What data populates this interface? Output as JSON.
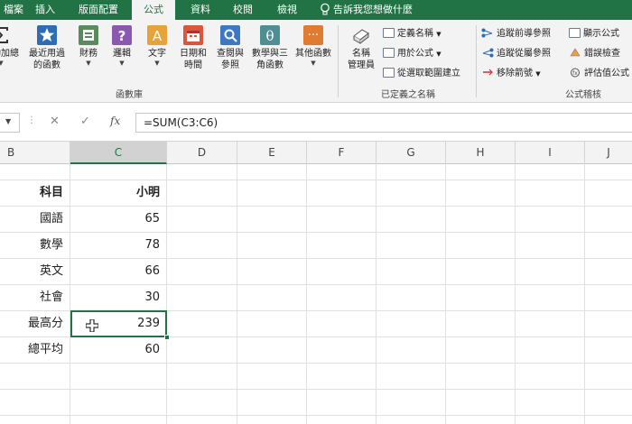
{
  "ribbon_tabs": [
    {
      "label": "檔案"
    },
    {
      "label": "插入"
    },
    {
      "label": "版面配置"
    },
    {
      "label": "公式",
      "active": true
    },
    {
      "label": "資料"
    },
    {
      "label": "校閱"
    },
    {
      "label": "檢視"
    }
  ],
  "tell_me": "告訴我您想做什麼",
  "function_library": {
    "group_label": "函數庫",
    "buttons": [
      {
        "label_1": "自動加總",
        "icon": "autosum-icon"
      },
      {
        "label_1": "最近用過",
        "label_2": "的函數",
        "icon": "recent-star-icon"
      },
      {
        "label_1": "財務",
        "icon": "financial-book-icon"
      },
      {
        "label_1": "邏輯",
        "icon": "logical-question-icon"
      },
      {
        "label_1": "文字",
        "icon": "text-a-icon"
      },
      {
        "label_1": "日期和",
        "label_2": "時間",
        "icon": "calendar-icon"
      },
      {
        "label_1": "查閱與",
        "label_2": "參照",
        "icon": "lookup-magnifier-icon"
      },
      {
        "label_1": "數學與三",
        "label_2": "角函數",
        "icon": "math-theta-icon"
      },
      {
        "label_1": "其他函數",
        "icon": "more-functions-icon"
      }
    ]
  },
  "defined_names": {
    "group_label": "已定義之名稱",
    "name_manager_1": "名稱",
    "name_manager_2": "管理員",
    "define_name": "定義名稱",
    "use_in_formula": "用於公式",
    "create_from_selection": "從選取範圍建立"
  },
  "formula_auditing": {
    "group_label": "公式稽核",
    "trace_precedents": "追蹤前導參照",
    "trace_dependents": "追蹤從屬參照",
    "remove_arrows": "移除箭號",
    "show_formulas": "顯示公式",
    "error_checking": "錯誤檢查",
    "evaluate_formula": "評估值公式"
  },
  "formula_bar": {
    "fx": "fx",
    "formula": "=SUM(C3:C6)"
  },
  "columns": [
    "B",
    "C",
    "D",
    "E",
    "F",
    "G",
    "H",
    "I",
    "J"
  ],
  "selected_column": "C",
  "table": {
    "header": {
      "subject": "科目",
      "student": "小明"
    },
    "rows": [
      {
        "subject": "國語",
        "score": "65"
      },
      {
        "subject": "數學",
        "score": "78"
      },
      {
        "subject": "英文",
        "score": "66"
      },
      {
        "subject": "社會",
        "score": "30"
      },
      {
        "subject": "最高分",
        "score": "239"
      },
      {
        "subject": "總平均",
        "score": "60"
      }
    ]
  },
  "colors": {
    "excel_green": "#217346",
    "ribbon_bg": "#f3f3f3"
  }
}
